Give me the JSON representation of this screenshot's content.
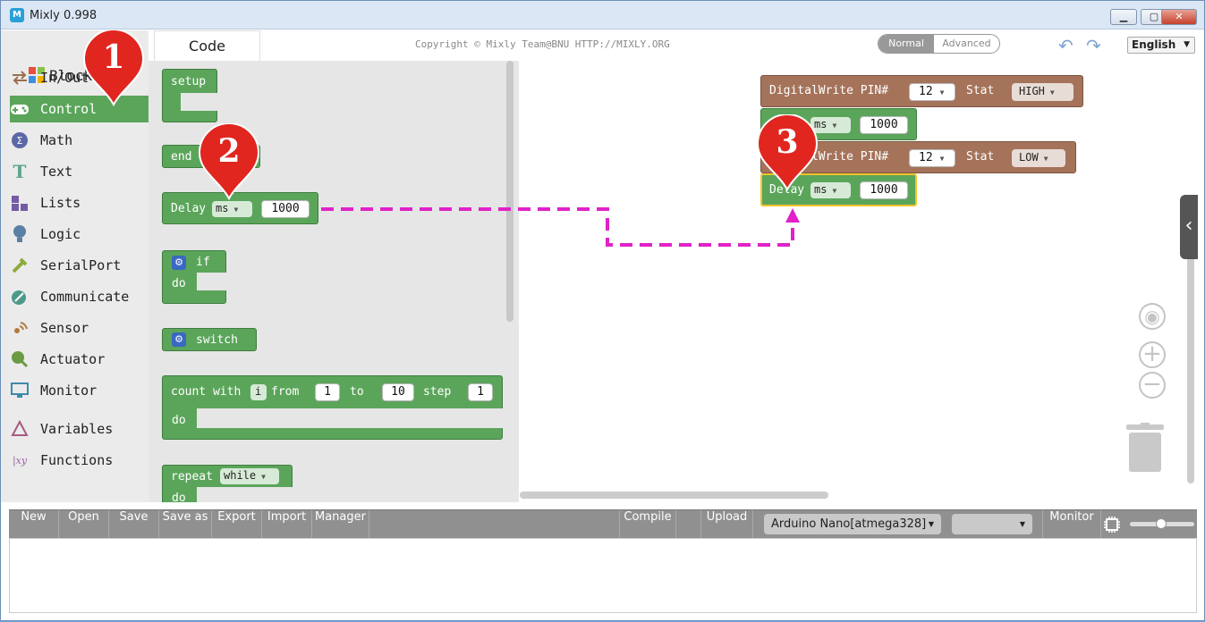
{
  "window": {
    "title": "Mixly 0.998"
  },
  "sidebar": {
    "items": [
      {
        "label": "In/Out"
      },
      {
        "label": "Control"
      },
      {
        "label": "Math"
      },
      {
        "label": "Text"
      },
      {
        "label": "Lists"
      },
      {
        "label": "Logic"
      },
      {
        "label": "SerialPort"
      },
      {
        "label": "Communicate"
      },
      {
        "label": "Sensor"
      },
      {
        "label": "Actuator"
      },
      {
        "label": "Monitor"
      },
      {
        "label": "Variables"
      },
      {
        "label": "Functions"
      }
    ]
  },
  "tabs": {
    "blocks": "Block",
    "code": "Code"
  },
  "header": {
    "copyright": "Copyright © Mixly Team@BNU HTTP://MIXLY.ORG",
    "mode_normal": "Normal",
    "mode_advanced": "Advanced",
    "language": "English"
  },
  "flyout": {
    "setup": "setup",
    "end": "end",
    "delay": "Delay",
    "delay_unit": "ms",
    "delay_value": "1000",
    "if": "if",
    "do": "do",
    "switch": "switch",
    "count_with": "count with",
    "count_var": "i",
    "from": "from",
    "from_val": "1",
    "to": "to",
    "to_val": "10",
    "step": "step",
    "step_val": "1",
    "repeat": "repeat",
    "repeat_mode": "while"
  },
  "workspace": {
    "b1": {
      "label": "DigitalWrite PIN#",
      "pin": "12",
      "stat": "Stat",
      "value": "HIGH"
    },
    "b2": {
      "unit": "ms",
      "value": "1000"
    },
    "b3": {
      "label": "DigitalWrite PIN#",
      "pin": "12",
      "stat": "Stat",
      "value": "LOW"
    },
    "b4": {
      "label": "Delay",
      "unit": "ms",
      "value": "1000"
    }
  },
  "markers": [
    "1",
    "2",
    "3"
  ],
  "toolbar": {
    "new": "New",
    "open": "Open",
    "save": "Save",
    "save_as": "Save as",
    "export": "Export",
    "import": "Import",
    "manager": "Manager",
    "compile": "Compile",
    "upload": "Upload",
    "board": "Arduino Nano[atmega328]",
    "port": "",
    "monitor": "Monitor"
  },
  "colors": {
    "control": "#5ba55b",
    "io": "#a5735a",
    "marker": "#e0261f",
    "arrow": "#e022c8"
  }
}
